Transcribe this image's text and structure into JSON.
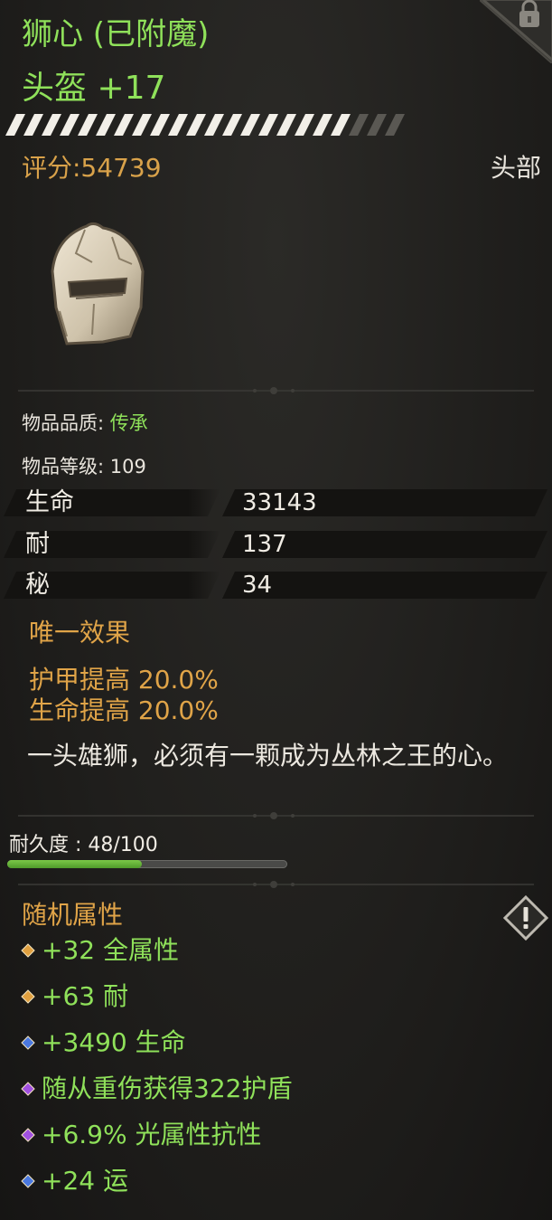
{
  "item": {
    "name": "狮心 (已附魔)",
    "type": "头盔 +17",
    "score": "评分:54739",
    "slot": "头部"
  },
  "properties": {
    "quality_label": "物品品质:",
    "quality_value": "传承",
    "level_text": "物品等级: 109"
  },
  "stats": [
    {
      "label": "生命",
      "value": "33143"
    },
    {
      "label": "耐",
      "value": "137"
    },
    {
      "label": "秘",
      "value": "34"
    }
  ],
  "unique": {
    "title": "唯一效果",
    "lines": [
      "护甲提高 20.0%",
      "生命提高 20.0%"
    ]
  },
  "flavor": "一头雄狮，必须有一颗成为丛林之王的心。",
  "durability": {
    "text": "耐久度 : 48/100",
    "current": 48,
    "max": 100
  },
  "random_attributes": {
    "title": "随机属性",
    "items": [
      {
        "text": "+32 全属性",
        "gem_color": "#e0a040"
      },
      {
        "text": "+63 耐",
        "gem_color": "#e0a040"
      },
      {
        "text": "+3490 生命",
        "gem_color": "#4a78e0"
      },
      {
        "text": "随从重伤获得322护盾",
        "gem_color": "#a050e0"
      },
      {
        "text": "+6.9% 光属性抗性",
        "gem_color": "#a050e0"
      },
      {
        "text": "+24 运",
        "gem_color": "#4a78e0"
      }
    ]
  },
  "colors": {
    "name_green": "#8fe15a",
    "gold": "#e0a448",
    "durability_fill": "#5fae34"
  },
  "icons": {
    "lock": "lock-icon",
    "helmet": "helmet-icon",
    "info": "warning-diamond-icon"
  }
}
